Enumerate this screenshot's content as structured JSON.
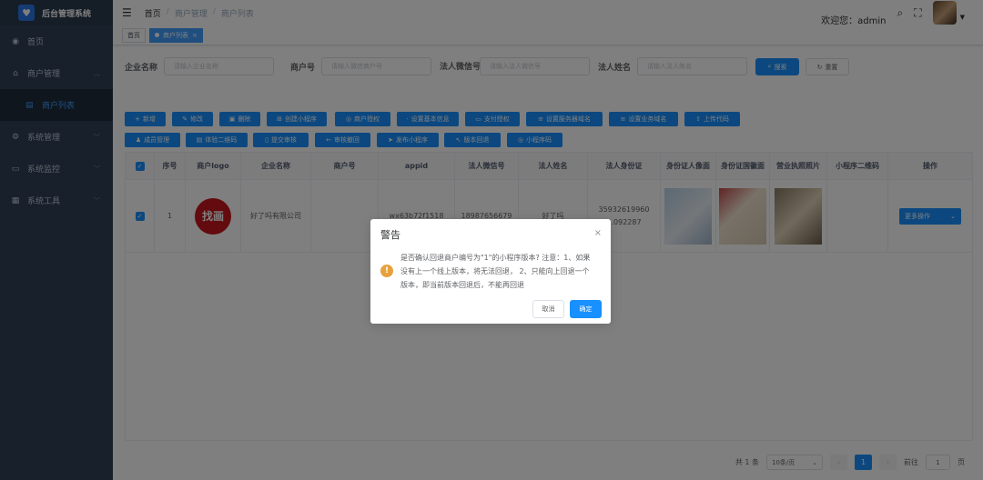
{
  "sidebar": {
    "logo_icon": "heart-icon",
    "title": "后台管理系统",
    "items": [
      {
        "label": "首页",
        "icon": "dashboard-icon"
      },
      {
        "label": "商户管理",
        "icon": "shop-icon"
      },
      {
        "label": "商户列表",
        "icon": "list-icon"
      },
      {
        "label": "系统管理",
        "icon": "gear-icon"
      },
      {
        "label": "系统监控",
        "icon": "monitor-icon"
      },
      {
        "label": "系统工具",
        "icon": "tool-icon"
      }
    ]
  },
  "navbar": {
    "breadcrumb": [
      "首页",
      "商户管理",
      "商户列表"
    ],
    "welcome": "欢迎您：admin"
  },
  "tags": {
    "home": "首页",
    "active": "商户列表"
  },
  "search": {
    "fields": [
      {
        "label": "企业名称",
        "placeholder": "请输入企业名称"
      },
      {
        "label": "商户号",
        "placeholder": "请输入微信商户号"
      },
      {
        "label": "法人微信号",
        "placeholder": "请输入法人微信号"
      },
      {
        "label": "法人姓名",
        "placeholder": "请输入法人姓名"
      }
    ],
    "search_label": "搜索",
    "reset_label": "重置"
  },
  "toolbar": {
    "row1": [
      "新增",
      "修改",
      "删除",
      "创建小程序",
      "商户授权",
      "设置基本信息",
      "支付授权",
      "设置服务器域名",
      "设置业务域名",
      "上传代码"
    ],
    "row2": [
      "成员管理",
      "体验二维码",
      "提交审核",
      "审核撤回",
      "发布小程序",
      "版本回退",
      "小程序码"
    ]
  },
  "table": {
    "headers": [
      "序号",
      "商户logo",
      "企业名称",
      "商户号",
      "appid",
      "法人微信号",
      "法人姓名",
      "法人身份证",
      "身份证人像面",
      "身份证国徽面",
      "营业执照照片",
      "小程序二维码",
      "操作"
    ],
    "rows": [
      {
        "index": "1",
        "logo_text": "找画",
        "company": "好了吗有限公司",
        "merchant_no": "",
        "appid": "wx63b72f1518",
        "wechat": "18987656679",
        "name": "好了吗",
        "id_card": "35932619960 ...092287",
        "action": "更多操作"
      }
    ]
  },
  "pagination": {
    "total": "共 1 条",
    "page_size": "10条/页",
    "current_page": "1",
    "goto_label": "前往",
    "goto_value": "1",
    "page_unit": "页"
  },
  "dialog": {
    "title": "警告",
    "message": "是否确认回退商户编号为\"1\"的小程序版本? 注意：1、如果没有上一个线上版本，将无法回退， 2、只能向上回退一个版本，即当前版本回退后，不能再回退",
    "cancel_label": "取消",
    "ok_label": "确定"
  }
}
